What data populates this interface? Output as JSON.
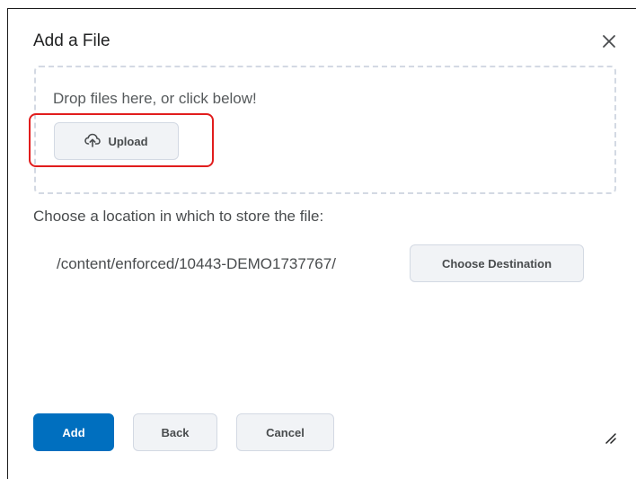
{
  "dialog": {
    "title": "Add a File",
    "close_icon": "close-icon",
    "dropzone_text": "Drop files here, or click below!",
    "upload_button": {
      "label": "Upload",
      "icon": "cloud-upload-icon"
    },
    "location_label": "Choose a location in which to store the file:",
    "path": "/content/enforced/10443-DEMO1737767/",
    "choose_destination_label": "Choose Destination",
    "footer": {
      "add_label": "Add",
      "back_label": "Back",
      "cancel_label": "Cancel"
    }
  },
  "colors": {
    "primary": "#006fbf",
    "highlight": "#e11d1d",
    "button_bg": "#f1f3f6",
    "border": "#d3d9e3"
  }
}
